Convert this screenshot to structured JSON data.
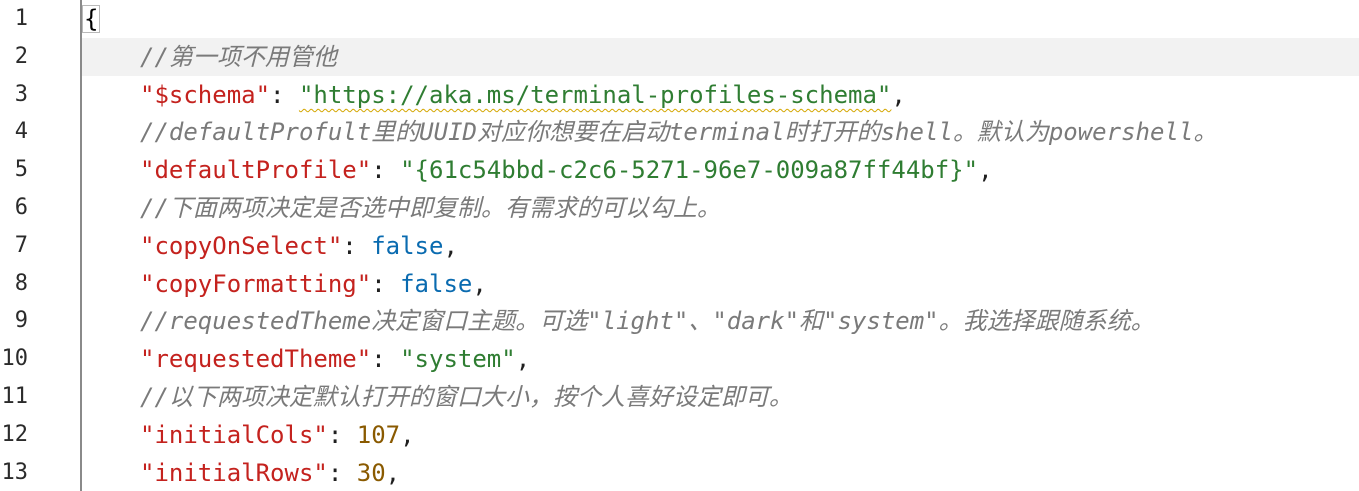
{
  "editor": {
    "line_numbers": [
      "1",
      "2",
      "3",
      "4",
      "5",
      "6",
      "7",
      "8",
      "9",
      "10",
      "11",
      "12",
      "13"
    ],
    "lines": {
      "l1": {
        "open_brace": "{"
      },
      "l2": {
        "comment": "//第一项不用管他"
      },
      "l3": {
        "key": "\"$schema\"",
        "sep": ": ",
        "value": "\"https://aka.ms/terminal-profiles-schema\"",
        "end": ","
      },
      "l4": {
        "comment": "//defaultProfult里的UUID对应你想要在启动terminal时打开的shell。默认为powershell。"
      },
      "l5": {
        "key": "\"defaultProfile\"",
        "sep": ": ",
        "value": "\"{61c54bbd-c2c6-5271-96e7-009a87ff44bf}\"",
        "end": ","
      },
      "l6": {
        "comment": "//下面两项决定是否选中即复制。有需求的可以勾上。"
      },
      "l7": {
        "key": "\"copyOnSelect\"",
        "sep": ": ",
        "value": "false",
        "end": ","
      },
      "l8": {
        "key": "\"copyFormatting\"",
        "sep": ": ",
        "value": "false",
        "end": ","
      },
      "l9": {
        "comment": "//requestedTheme决定窗口主题。可选\"light\"、\"dark\"和\"system\"。我选择跟随系统。"
      },
      "l10": {
        "key": "\"requestedTheme\"",
        "sep": ": ",
        "value": "\"system\"",
        "end": ","
      },
      "l11": {
        "comment": "//以下两项决定默认打开的窗口大小，按个人喜好设定即可。"
      },
      "l12": {
        "key": "\"initialCols\"",
        "sep": ": ",
        "value": "107",
        "end": ","
      },
      "l13": {
        "key": "\"initialRows\"",
        "sep": ": ",
        "value": "30",
        "end": ","
      }
    },
    "colors": {
      "comment": "#7a7a7a",
      "key": "#c4221e",
      "string": "#2f7d32",
      "boolean": "#0a6bb0",
      "number": "#8a5a00",
      "current_line": "#f2f2f2"
    }
  }
}
